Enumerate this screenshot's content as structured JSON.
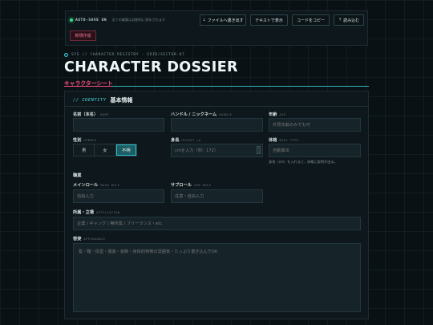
{
  "toolbar": {
    "autosave_title": "AUTO-SAVE ON",
    "autosave_note": "全ての編集は自動的に保存されます",
    "buttons": {
      "export_file": "ファイルへ書き出す",
      "show_text": "テキストで表示",
      "copy_code": "コードをコピー",
      "import": "読み込む"
    },
    "new_button": "新規作成"
  },
  "header": {
    "breadcrumb": "SYS // CHARACTER REGISTRY - GRID/SECTOR-07",
    "title": "CHARACTER DOSSIER",
    "subtitle": "キャラクターシート"
  },
  "identity": {
    "section_tag": "// IDENTITY",
    "section_title": "基本情報",
    "name": {
      "label": "名前（本名）",
      "en": "NAME",
      "value": ""
    },
    "handle": {
      "label": "ハンドル / ニックネーム",
      "en": "HANDLE",
      "value": ""
    },
    "age": {
      "label": "年齢",
      "en": "AGE",
      "placeholder": "外見年齢のみでも可"
    },
    "gender": {
      "label": "性別",
      "en": "GENDER",
      "options": [
        "男",
        "女",
        "不明"
      ],
      "selected": "不明"
    },
    "height": {
      "label": "身長",
      "en": "HEIGHT cm",
      "placeholder": "cmを入力（例：172）"
    },
    "weight": {
      "label": "体格",
      "en": "BODY TYPE",
      "placeholder": "自動算出",
      "hint": "身長（cm）を入れると、体格に説明が出る。"
    },
    "occupation": {
      "group_label": "職業"
    },
    "main_role": {
      "label": "メインロール",
      "en": "MAIN ROLE",
      "placeholder": "自由入力"
    },
    "sub_role": {
      "label": "サブロール",
      "en": "SUB ROLE",
      "placeholder": "任意・自由入力"
    },
    "affiliation": {
      "label": "所属・立場",
      "en": "AFFILIATION",
      "placeholder": "企業 / ギャング / 無所属 / フリーランス・etc"
    },
    "appearance": {
      "label": "容姿",
      "en": "APPEARANCE",
      "placeholder": "髪・瞳・体型・服装・装飾・身体的特徴の雰囲気・たっぷり書き込んでOK"
    }
  },
  "colors": {
    "accent": "#2bb5bf",
    "pink": "#ef4f7e",
    "status": "#39d98a"
  }
}
